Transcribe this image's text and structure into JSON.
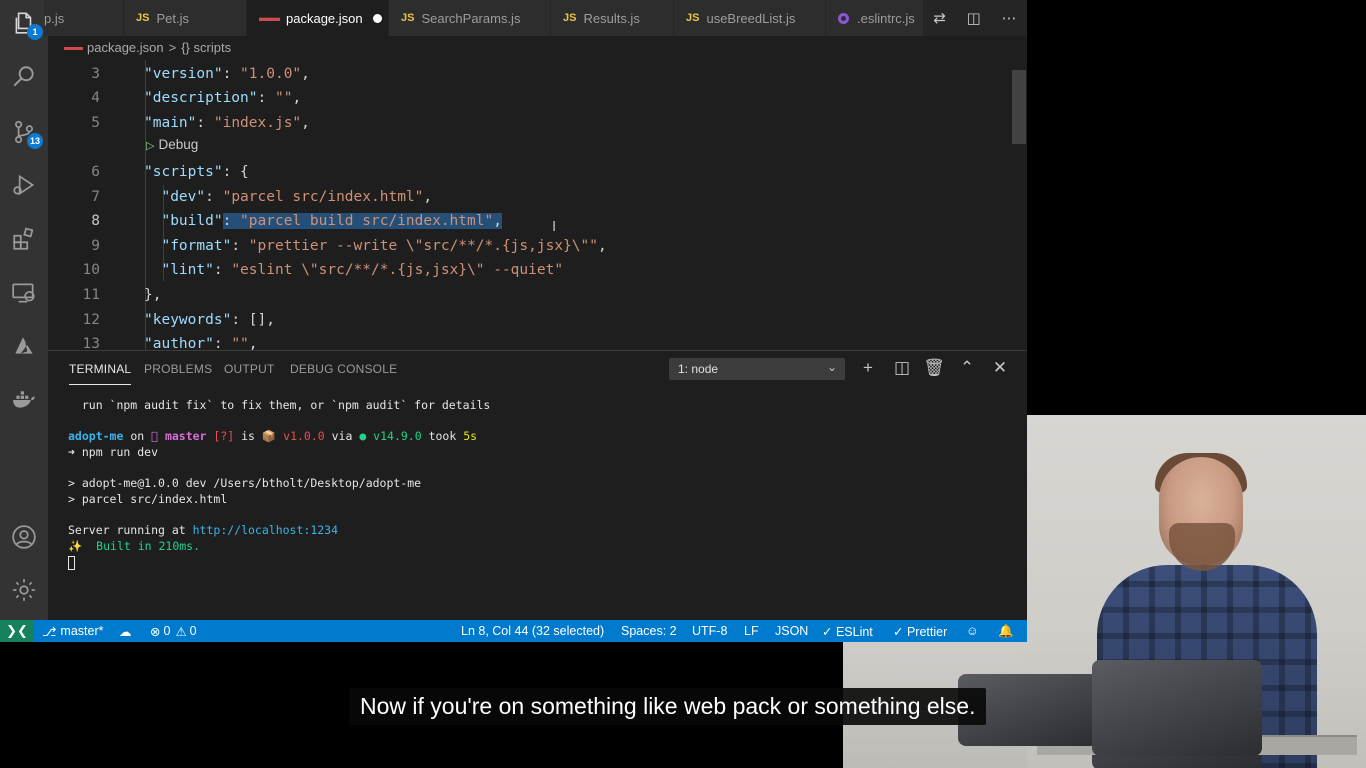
{
  "tabs": [
    {
      "label": "p.js",
      "type": "js"
    },
    {
      "label": "Pet.js",
      "type": "js"
    },
    {
      "label": "package.json",
      "type": "json",
      "active": true,
      "dirty": true
    },
    {
      "label": "SearchParams.js",
      "type": "js"
    },
    {
      "label": "Results.js",
      "type": "js"
    },
    {
      "label": "useBreedList.js",
      "type": "js"
    },
    {
      "label": ".eslintrc.js",
      "type": "eslint"
    }
  ],
  "js_badge": "JS",
  "activity_bar": {
    "explorer_badge": "1",
    "scm_badge": "13"
  },
  "breadcrumb": {
    "file": "package.json",
    "separator": ">",
    "symbol": "{} scripts"
  },
  "editor": {
    "codelens": "Debug",
    "lines": [
      {
        "no": "3"
      },
      {
        "no": "4"
      },
      {
        "no": "5"
      },
      {
        "no": "6"
      },
      {
        "no": "7"
      },
      {
        "no": "8"
      },
      {
        "no": "9"
      },
      {
        "no": "10"
      },
      {
        "no": "11"
      },
      {
        "no": "12"
      },
      {
        "no": "13"
      }
    ],
    "code": {
      "l3": [
        "\"version\"",
        ": ",
        "\"1.0.0\"",
        ","
      ],
      "l4": [
        "\"description\"",
        ": ",
        "\"\"",
        ","
      ],
      "l5": [
        "\"main\"",
        ": ",
        "\"index.js\"",
        ","
      ],
      "l6": [
        "\"scripts\"",
        ": {"
      ],
      "l7": [
        "\"dev\"",
        ": ",
        "\"parcel src/index.html\"",
        ","
      ],
      "l8": [
        "\"build\"",
        ": ",
        "\"parcel build src/index.html\"",
        ","
      ],
      "l9": [
        "\"format\"",
        ": ",
        "\"prettier --write \\\"src/**/*.{js,jsx}\\\"\"",
        ","
      ],
      "l10": [
        "\"lint\"",
        ": ",
        "\"eslint \\\"src/**/*.{js,jsx}\\\" --quiet\""
      ],
      "l11": [
        "},"
      ],
      "l12": [
        "\"keywords\"",
        ": [],"
      ],
      "l13": [
        "\"author\"",
        ": ",
        "\"\"",
        ","
      ]
    }
  },
  "panel": {
    "tabs": [
      "TERMINAL",
      "PROBLEMS",
      "OUTPUT",
      "DEBUG CONSOLE"
    ],
    "active_tab": "TERMINAL",
    "terminal_select": "1: node"
  },
  "terminal": {
    "audit_line": "  run `npm audit fix` to fix them, or `npm audit` for details",
    "prompt": {
      "dir": "adopt-me",
      "on": " on ",
      "branch": " master",
      "status": " [?]",
      "is": " is ",
      "package_icon": "📦",
      "version": " v1.0.0",
      "via": " via ",
      "node_dot": "●",
      "node_version": " v14.9.0",
      "took": " took ",
      "duration": "5s"
    },
    "command": "➜ npm run dev",
    "npm_line1": "> adopt-me@1.0.0 dev /Users/btholt/Desktop/adopt-me",
    "npm_line2": "> parcel src/index.html",
    "server_prefix": "Server running at ",
    "server_url": "http://localhost:1234",
    "built_icon": "✨",
    "built_text": "  Built in 210ms."
  },
  "status_bar": {
    "branch": "master*",
    "errors": "0",
    "warnings": "0",
    "cursor": "Ln 8, Col 44 (32 selected)",
    "spaces": "Spaces: 2",
    "encoding": "UTF-8",
    "eol": "LF",
    "language": "JSON",
    "eslint": "✓ ESLint",
    "prettier": "✓ Prettier"
  },
  "caption": "Now if you're on something like web pack or something else.",
  "colors": {
    "status_bar": "#007acc",
    "selection": "#264f78",
    "json_key": "#9cdcfe",
    "json_string": "#ce9178"
  }
}
